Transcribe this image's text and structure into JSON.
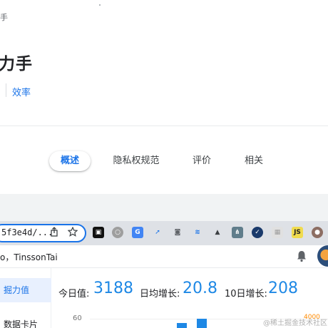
{
  "header": {
    "breadcrumb_tail": "手",
    "app_title": "力手",
    "category": "效率"
  },
  "tabs": [
    {
      "label": "概述",
      "active": true
    },
    {
      "label": "隐私权规范",
      "active": false
    },
    {
      "label": "评价",
      "active": false
    },
    {
      "label": "相关",
      "active": false
    }
  ],
  "browser": {
    "url": "5f3e4d/...",
    "extensions": [
      "app-icon",
      "record-icon",
      "translate-icon",
      "rocket-icon",
      "camera-icon",
      "layers-icon",
      "triangle-icon",
      "hub-icon",
      "check-icon",
      "grid-icon",
      "js-icon",
      "tomato-icon"
    ]
  },
  "app": {
    "greeting": "o，TinssonTai",
    "sidebar": [
      "掘力值",
      "数据卡片"
    ],
    "stats": [
      {
        "label": "今日值:",
        "value": "3188"
      },
      {
        "label": "日均增长:",
        "value": "20.8"
      },
      {
        "label": "10日增长:",
        "value": "208"
      }
    ]
  },
  "chart_data": {
    "type": "bar",
    "y_tick_label": "60",
    "right_axis_label": "4000"
  },
  "watermark": "@稀土掘金技术社区",
  "colors": {
    "accent": "#1a73e8",
    "stat": "#1e88e5",
    "orange": "#ff8a00"
  }
}
